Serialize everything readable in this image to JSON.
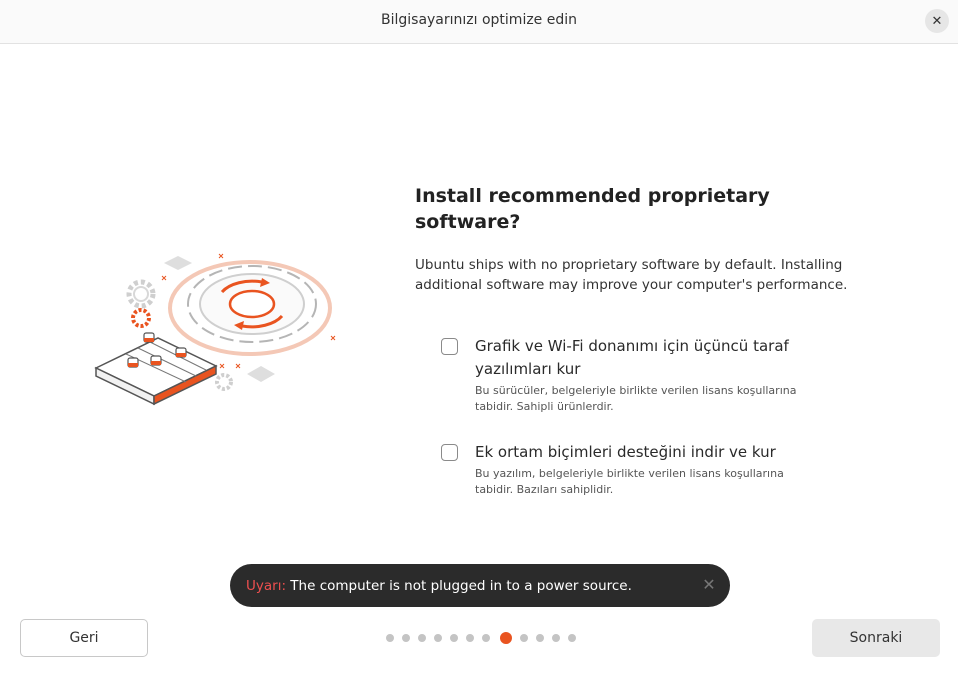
{
  "window": {
    "title": "Bilgisayarınızı optimize edin",
    "close_glyph": "✕"
  },
  "main": {
    "heading": "Install recommended proprietary software?",
    "description": "Ubuntu ships with no proprietary software by default. Installing additional software may improve your computer's performance.",
    "options": [
      {
        "label": "Grafik ve Wi-Fi donanımı için üçüncü taraf yazılımları kur",
        "sublabel": "Bu sürücüler, belgeleriyle birlikte verilen lisans koşullarına tabidir. Sahipli ürünlerdir.",
        "checked": false
      },
      {
        "label": "Ek ortam biçimleri desteğini indir ve kur",
        "sublabel": "Bu yazılım, belgeleriyle birlikte verilen lisans koşullarına tabidir. Bazıları sahiplidir.",
        "checked": false
      }
    ]
  },
  "toast": {
    "warning_label": "Uyarı:",
    "message": "The computer is not plugged in to a power source.",
    "close_glyph": "✕"
  },
  "footer": {
    "back_label": "Geri",
    "next_label": "Sonraki",
    "progress": {
      "total_steps": 12,
      "current_step": 8
    }
  },
  "colors": {
    "accent": "#e95420",
    "warning": "#ef4f4f",
    "toast_bg": "#2b2b2b"
  },
  "icons": [
    "close-icon",
    "gear-illustration",
    "checkbox-icon"
  ]
}
